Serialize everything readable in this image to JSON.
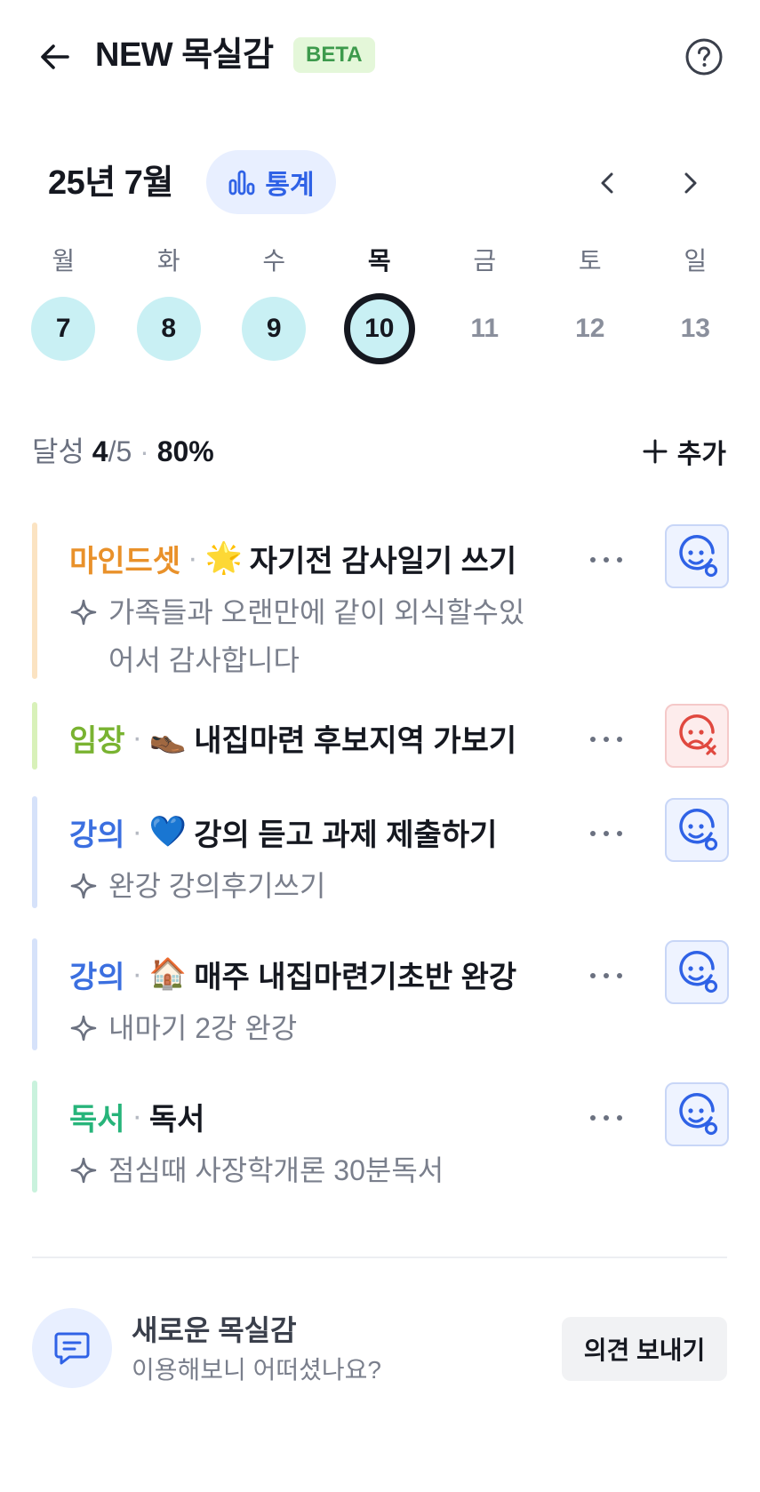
{
  "header": {
    "title": "NEW 목실감",
    "badge": "BETA",
    "back_icon": "arrow-left-icon",
    "help_icon": "question-circle-icon"
  },
  "calendar": {
    "month_label": "25년 7월",
    "stats_label": "통계",
    "weekdays": [
      "월",
      "화",
      "수",
      "목",
      "금",
      "토",
      "일"
    ],
    "dates": [
      {
        "day": "7",
        "state": "done"
      },
      {
        "day": "8",
        "state": "done"
      },
      {
        "day": "9",
        "state": "done"
      },
      {
        "day": "10",
        "state": "today"
      },
      {
        "day": "11",
        "state": "future"
      },
      {
        "day": "12",
        "state": "future"
      },
      {
        "day": "13",
        "state": "future"
      }
    ],
    "active_weekday_index": 3
  },
  "summary": {
    "label": "달성",
    "done": "4",
    "slash": "/",
    "total": "5",
    "dot": "·",
    "percent": "80%",
    "add_label": "추가"
  },
  "habits": [
    {
      "category": "마인드셋",
      "emoji": "🌟",
      "title": "자기전 감사일기 쓰기",
      "note": "가족들과 오랜만에 같이 외식할수있어서 감사합니다",
      "status": "success",
      "category_color": "#e9912a",
      "bar_color": "#fbe3c2"
    },
    {
      "category": "임장",
      "emoji": "👞",
      "title": "내집마련 후보지역 가보기",
      "note": "",
      "status": "fail",
      "category_color": "#79b331",
      "bar_color": "#d8f1b9"
    },
    {
      "category": "강의",
      "emoji": "💙",
      "title": "강의 듣고 과제 제출하기",
      "note": "완강 강의후기쓰기",
      "status": "success",
      "category_color": "#3b6fe0",
      "bar_color": "#d6e2fa"
    },
    {
      "category": "강의",
      "emoji": "🏠",
      "title": "매주 내집마련기초반 완강",
      "note": "내마기 2강 완강",
      "status": "success",
      "category_color": "#3b6fe0",
      "bar_color": "#d6e2fa"
    },
    {
      "category": "독서",
      "emoji": "",
      "title": "독서",
      "note": "점심때 사장학개론 30분독서",
      "status": "success",
      "category_color": "#27b47a",
      "bar_color": "#c9f2dd"
    }
  ],
  "feedback": {
    "title": "새로운 목실감",
    "subtitle": "이용해보니 어떠셨나요?",
    "button_label": "의견 보내기",
    "icon": "chat-bubble-icon"
  },
  "colors": {
    "accent": "#2f62e6",
    "success_icon": "#2f62e6",
    "fail_icon": "#e0483f"
  }
}
